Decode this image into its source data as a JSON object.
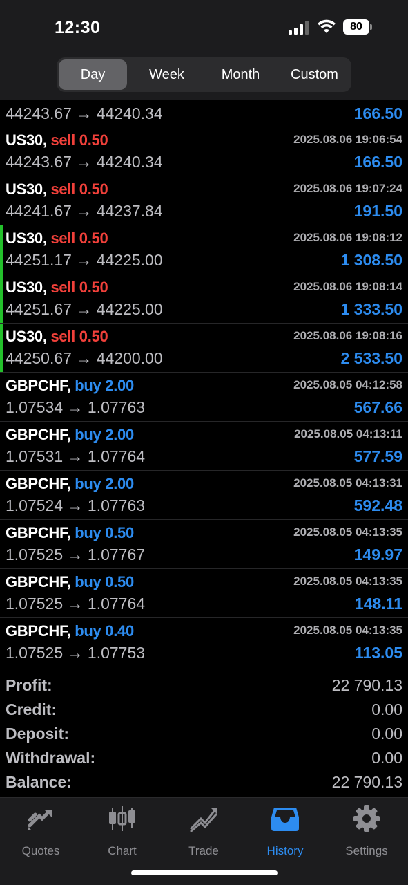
{
  "status_bar": {
    "time": "12:30",
    "battery": "80"
  },
  "segments": [
    {
      "label": "Day",
      "active": true
    },
    {
      "label": "Week",
      "active": false
    },
    {
      "label": "Month",
      "active": false
    },
    {
      "label": "Custom",
      "active": false
    }
  ],
  "trades": [
    {
      "symbol": "",
      "side_label": "",
      "side": "",
      "date": "",
      "prices": "44243.67 → 44240.34",
      "profit": "166.50",
      "marker": false,
      "partial": true
    },
    {
      "symbol": "US30,",
      "side_label": "sell 0.50",
      "side": "sell",
      "date": "2025.08.06 19:06:54",
      "prices": "44243.67 → 44240.34",
      "profit": "166.50",
      "marker": false
    },
    {
      "symbol": "US30,",
      "side_label": "sell 0.50",
      "side": "sell",
      "date": "2025.08.06 19:07:24",
      "prices": "44241.67 → 44237.84",
      "profit": "191.50",
      "marker": false
    },
    {
      "symbol": "US30,",
      "side_label": "sell 0.50",
      "side": "sell",
      "date": "2025.08.06 19:08:12",
      "prices": "44251.17 → 44225.00",
      "profit": "1 308.50",
      "marker": true
    },
    {
      "symbol": "US30,",
      "side_label": "sell 0.50",
      "side": "sell",
      "date": "2025.08.06 19:08:14",
      "prices": "44251.67 → 44225.00",
      "profit": "1 333.50",
      "marker": true
    },
    {
      "symbol": "US30,",
      "side_label": "sell 0.50",
      "side": "sell",
      "date": "2025.08.06 19:08:16",
      "prices": "44250.67 → 44200.00",
      "profit": "2 533.50",
      "marker": true
    },
    {
      "symbol": "GBPCHF,",
      "side_label": "buy 2.00",
      "side": "buy",
      "date": "2025.08.05 04:12:58",
      "prices": "1.07534 → 1.07763",
      "profit": "567.66",
      "marker": false
    },
    {
      "symbol": "GBPCHF,",
      "side_label": "buy 2.00",
      "side": "buy",
      "date": "2025.08.05 04:13:11",
      "prices": "1.07531 → 1.07764",
      "profit": "577.59",
      "marker": false
    },
    {
      "symbol": "GBPCHF,",
      "side_label": "buy 2.00",
      "side": "buy",
      "date": "2025.08.05 04:13:31",
      "prices": "1.07524 → 1.07763",
      "profit": "592.48",
      "marker": false
    },
    {
      "symbol": "GBPCHF,",
      "side_label": "buy 0.50",
      "side": "buy",
      "date": "2025.08.05 04:13:35",
      "prices": "1.07525 → 1.07767",
      "profit": "149.97",
      "marker": false
    },
    {
      "symbol": "GBPCHF,",
      "side_label": "buy 0.50",
      "side": "buy",
      "date": "2025.08.05 04:13:35",
      "prices": "1.07525 → 1.07764",
      "profit": "148.11",
      "marker": false
    },
    {
      "symbol": "GBPCHF,",
      "side_label": "buy 0.40",
      "side": "buy",
      "date": "2025.08.05 04:13:35",
      "prices": "1.07525 → 1.07753",
      "profit": "113.05",
      "marker": false
    }
  ],
  "summary": [
    {
      "label": "Profit:",
      "value": "22 790.13"
    },
    {
      "label": "Credit:",
      "value": "0.00"
    },
    {
      "label": "Deposit:",
      "value": "0.00"
    },
    {
      "label": "Withdrawal:",
      "value": "0.00"
    },
    {
      "label": "Balance:",
      "value": "22 790.13"
    }
  ],
  "tabs": [
    {
      "label": "Quotes",
      "icon": "quotes-icon",
      "active": false
    },
    {
      "label": "Chart",
      "icon": "chart-icon",
      "active": false
    },
    {
      "label": "Trade",
      "icon": "trade-icon",
      "active": false
    },
    {
      "label": "History",
      "icon": "history-icon",
      "active": true
    },
    {
      "label": "Settings",
      "icon": "gear-icon",
      "active": false
    }
  ],
  "colors": {
    "accent": "#2d8cf0",
    "sell": "#f0403a",
    "marker": "#23c02b"
  }
}
